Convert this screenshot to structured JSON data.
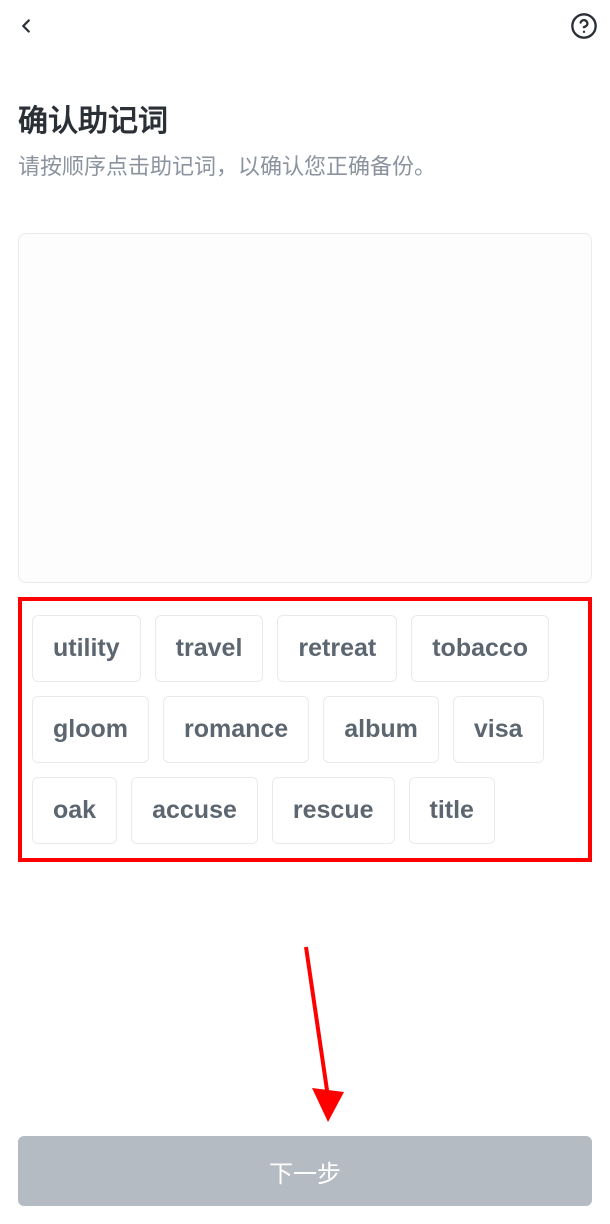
{
  "header": {
    "back_icon": "chevron-left",
    "help_icon": "question-circle"
  },
  "page": {
    "title": "确认助记词",
    "subtitle": "请按顺序点击助记词，以确认您正确备份。"
  },
  "mnemonic_words": [
    "utility",
    "travel",
    "retreat",
    "tobacco",
    "gloom",
    "romance",
    "album",
    "visa",
    "oak",
    "accuse",
    "rescue",
    "title"
  ],
  "footer": {
    "next_button_label": "下一步"
  },
  "annotation": {
    "highlight_color": "#ff0000",
    "arrow_target": "next-button"
  }
}
